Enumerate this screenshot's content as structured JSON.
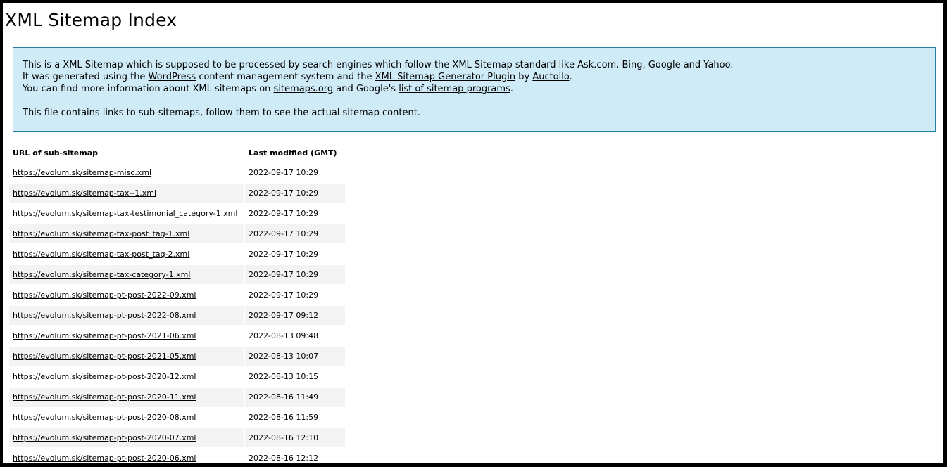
{
  "page": {
    "title": "XML Sitemap Index"
  },
  "intro": {
    "line1": "This is a XML Sitemap which is supposed to be processed by search engines which follow the XML Sitemap standard like Ask.com, Bing, Google and Yahoo.",
    "line2_pre": "It was generated using the ",
    "line2_link1": "WordPress",
    "line2_mid": " content management system and the ",
    "line2_link2": "XML Sitemap Generator Plugin",
    "line2_by": " by ",
    "line2_link3": "Auctollo",
    "line2_end": ".",
    "line3_pre": "You can find more information about XML sitemaps on ",
    "line3_link1": "sitemaps.org",
    "line3_mid": " and Google's ",
    "line3_link2": "list of sitemap programs",
    "line3_end": ".",
    "line4": "This file contains links to sub-sitemaps, follow them to see the actual sitemap content."
  },
  "table": {
    "headers": [
      "URL of sub-sitemap",
      "Last modified (GMT)"
    ],
    "rows": [
      {
        "url": "https://evolum.sk/sitemap-misc.xml",
        "modified": "2022-09-17 10:29"
      },
      {
        "url": "https://evolum.sk/sitemap-tax--1.xml",
        "modified": "2022-09-17 10:29"
      },
      {
        "url": "https://evolum.sk/sitemap-tax-testimonial_category-1.xml",
        "modified": "2022-09-17 10:29"
      },
      {
        "url": "https://evolum.sk/sitemap-tax-post_tag-1.xml",
        "modified": "2022-09-17 10:29"
      },
      {
        "url": "https://evolum.sk/sitemap-tax-post_tag-2.xml",
        "modified": "2022-09-17 10:29"
      },
      {
        "url": "https://evolum.sk/sitemap-tax-category-1.xml",
        "modified": "2022-09-17 10:29"
      },
      {
        "url": "https://evolum.sk/sitemap-pt-post-2022-09.xml",
        "modified": "2022-09-17 10:29"
      },
      {
        "url": "https://evolum.sk/sitemap-pt-post-2022-08.xml",
        "modified": "2022-09-17 09:12"
      },
      {
        "url": "https://evolum.sk/sitemap-pt-post-2021-06.xml",
        "modified": "2022-08-13 09:48"
      },
      {
        "url": "https://evolum.sk/sitemap-pt-post-2021-05.xml",
        "modified": "2022-08-13 10:07"
      },
      {
        "url": "https://evolum.sk/sitemap-pt-post-2020-12.xml",
        "modified": "2022-08-13 10:15"
      },
      {
        "url": "https://evolum.sk/sitemap-pt-post-2020-11.xml",
        "modified": "2022-08-16 11:49"
      },
      {
        "url": "https://evolum.sk/sitemap-pt-post-2020-08.xml",
        "modified": "2022-08-16 11:59"
      },
      {
        "url": "https://evolum.sk/sitemap-pt-post-2020-07.xml",
        "modified": "2022-08-16 12:10"
      },
      {
        "url": "https://evolum.sk/sitemap-pt-post-2020-06.xml",
        "modified": "2022-08-16 12:12"
      }
    ]
  },
  "colors": {
    "intro_background": "#cfebf7",
    "intro_border": "#2b7ea1",
    "row_alt": "#f3f3f3"
  }
}
